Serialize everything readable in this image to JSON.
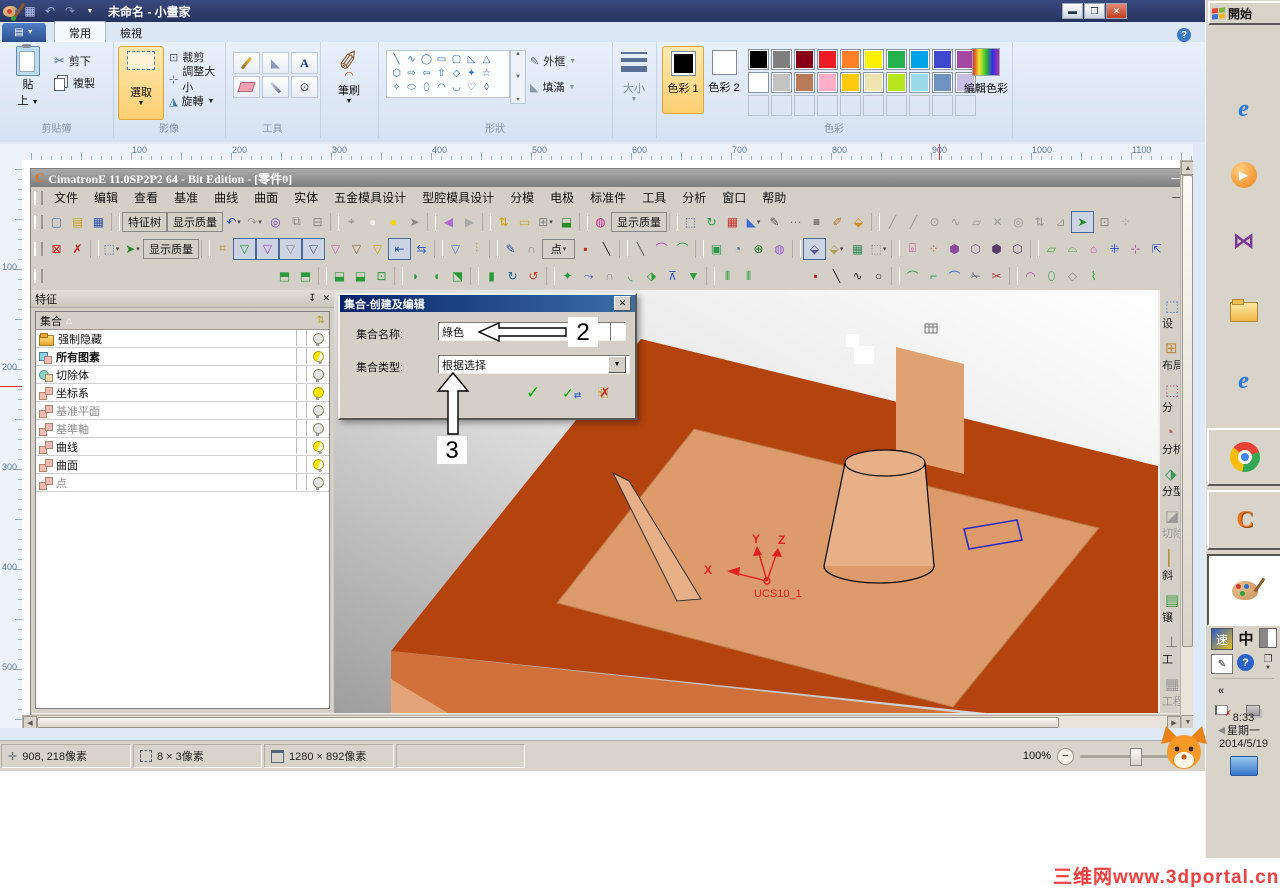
{
  "colors": {
    "model_top": "#b5430d",
    "model_front": "#d0703a",
    "model_pocket": "#dd9b6b",
    "model_boss": "#e0a173",
    "model_cyl": "#e7b086",
    "model_bevel": "#e2a478",
    "ucs": "#e02020",
    "selection_blue": "#2a2ac8"
  },
  "paint": {
    "window_title": "未命名 - 小畫家",
    "tabs": [
      {
        "label": "常用",
        "active": true
      },
      {
        "label": "檢視",
        "active": false
      }
    ],
    "help_icon": "?",
    "clipboard": {
      "group": "剪貼簿",
      "paste1": "貼",
      "paste2": "上",
      "cut": "剪下",
      "copy": "複製"
    },
    "image": {
      "group": "影像",
      "select": "選取",
      "crop": "裁剪",
      "resize": "調整大小",
      "rotate": "旋轉"
    },
    "tools_group": "工具",
    "brush_label": "筆刷",
    "shapes": {
      "group": "形狀",
      "outline": "外框",
      "fill": "填滿",
      "rows": [
        [
          "╲",
          "∿",
          "◯",
          "▭",
          "▢",
          "◺",
          "△"
        ],
        [
          "⬡",
          "⇨",
          "⇦",
          "⇧",
          "◇",
          "✦",
          "☆"
        ],
        [
          "✧",
          "⬭",
          "⬯",
          "◠",
          "◡",
          "♡",
          "◊"
        ]
      ]
    },
    "size_label": "大小",
    "colors_group": {
      "group": "色彩",
      "c1_label": "色彩 1",
      "c2_label": "色彩 2",
      "edit_label": "編輯色彩",
      "color1": "#000000",
      "color2": "#ffffff",
      "row1": [
        "#000000",
        "#7f7f7f",
        "#880015",
        "#ed1c24",
        "#ff7f27",
        "#fff200",
        "#22b14c",
        "#00a2e8",
        "#3f48cc",
        "#a349a4"
      ],
      "row2": [
        "#ffffff",
        "#c3c3c3",
        "#b97a57",
        "#ffaec9",
        "#ffc90e",
        "#efe4b0",
        "#b5e61d",
        "#99d9ea",
        "#7092be",
        "#c8bfe7"
      ]
    },
    "ruler_h": [
      100,
      200,
      300,
      400,
      500,
      600,
      700,
      800,
      900,
      1000,
      1100
    ],
    "ruler_v": [
      100,
      200,
      300,
      400,
      500
    ],
    "status": {
      "pos": "908, 218像素",
      "sel": "8 × 3像素",
      "size": "1280 × 892像素",
      "zoom": "100%"
    }
  },
  "cimatron": {
    "title": "CimatronE 11.0SP2P2 64 - Bit Edition - [零件0]",
    "menus": [
      "文件",
      "编辑",
      "查看",
      "基准",
      "曲线",
      "曲面",
      "实体",
      "五金模具设计",
      "型腔模具设计",
      "分模",
      "电极",
      "标准件",
      "工具",
      "分析",
      "窗口",
      "帮助"
    ],
    "toolbar1": [
      {
        "n": "new-file",
        "g": "▢",
        "c": "#4a6fae"
      },
      {
        "n": "open-file",
        "g": "▤",
        "c": "#c8a020"
      },
      {
        "n": "save-file",
        "g": "▦",
        "c": "#3355aa"
      },
      {
        "sep": 1
      },
      {
        "n": "feature-tree-button",
        "t": "特征树",
        "box": 1
      },
      {
        "n": "display-quality-button",
        "t": "显示质量"
      },
      {
        "n": "undo",
        "g": "↶",
        "c": "#2244cc",
        "dd": 1
      },
      {
        "n": "redo",
        "g": "↷",
        "c": "#9a9a9a",
        "dd": 1
      },
      {
        "n": "glasses",
        "g": "◎",
        "c": "#7a3cc8"
      },
      {
        "n": "copy-reference",
        "g": "⧉",
        "c": "#888"
      },
      {
        "n": "delete-reference",
        "g": "⊟",
        "c": "#888"
      },
      {
        "sep": 1
      },
      {
        "n": "bulb-pick",
        "g": "⌖",
        "c": "#888"
      },
      {
        "n": "bulb-white",
        "g": "●",
        "c": "#eee"
      },
      {
        "n": "bulb-yellow",
        "g": "●",
        "c": "#ffd700"
      },
      {
        "n": "bulb-cursor",
        "g": "➤",
        "c": "#888"
      },
      {
        "sep": 1
      },
      {
        "n": "back-arrow",
        "g": "◀",
        "c": "#b06ad0"
      },
      {
        "n": "forward-arrow",
        "g": "▶",
        "c": "#aaa"
      },
      {
        "sep": 1
      },
      {
        "n": "swap-entities",
        "g": "⇅",
        "c": "#d0a000"
      },
      {
        "n": "measure-ruler",
        "g": "▭",
        "c": "#caa520"
      },
      {
        "n": "grid-toggle",
        "g": "⊞",
        "c": "#888",
        "dd": 1
      },
      {
        "n": "add-stock",
        "g": "⬓",
        "c": "#2a8a2a"
      },
      {
        "sep": 1
      },
      {
        "n": "render-globe",
        "g": "◍",
        "c": "#cc2a8a"
      },
      {
        "n": "display-quality-button-2",
        "t": "显示质量"
      },
      {
        "sep": 1
      },
      {
        "n": "select-box",
        "g": "⬚",
        "c": "#4466aa"
      },
      {
        "n": "rotate-entity",
        "g": "↻",
        "c": "#2a9a4a"
      },
      {
        "n": "color-table",
        "g": "▦",
        "c": "#cc3333"
      },
      {
        "n": "fill-color",
        "g": "◣",
        "c": "#3a6ad0",
        "dd": 1
      },
      {
        "n": "pen-style",
        "g": "✎",
        "c": "#555"
      },
      {
        "n": "line-style",
        "g": "⋯",
        "c": "#777"
      },
      {
        "n": "line-width",
        "g": "≡",
        "c": "#222"
      },
      {
        "n": "brush-render",
        "g": "✐",
        "c": "#b07030"
      },
      {
        "n": "cube-gold",
        "g": "⬙",
        "c": "#d09020"
      },
      {
        "sep": 1
      },
      {
        "n": "sketch-line",
        "g": "╱",
        "c": "#999"
      },
      {
        "n": "sketch-line2",
        "g": "╱",
        "c": "#999"
      },
      {
        "n": "axis-circle",
        "g": "⊙",
        "c": "#999"
      },
      {
        "n": "curve-tool",
        "g": "∿",
        "c": "#999"
      },
      {
        "n": "plane-tool",
        "g": "▱",
        "c": "#999"
      },
      {
        "n": "delete-tool",
        "g": "✕",
        "c": "#999"
      },
      {
        "n": "hide-tool",
        "g": "◎",
        "c": "#999"
      },
      {
        "n": "flip-tool",
        "g": "⇅",
        "c": "#999"
      },
      {
        "n": "angle-tool",
        "g": "⊿",
        "c": "#999"
      },
      {
        "n": "pick-green",
        "g": "➤",
        "c": "#2a8a2a",
        "box": 1
      },
      {
        "n": "pick-box",
        "g": "⊡",
        "c": "#888"
      },
      {
        "n": "xyz-points",
        "g": "⁘",
        "c": "#999"
      }
    ],
    "toolbar2": [
      {
        "n": "selection-red-box",
        "g": "⊠",
        "c": "#cc2222"
      },
      {
        "n": "cursor-x",
        "g": "✗",
        "c": "#cc2222"
      },
      {
        "sep": 1
      },
      {
        "n": "marquee-cursor",
        "g": "⬚",
        "c": "#4466aa",
        "dd": 1
      },
      {
        "n": "pick-arrow",
        "g": "➤",
        "c": "#2a8a2a",
        "dd": 1
      },
      {
        "n": "display-quality-button-3",
        "t": "显示质量"
      },
      {
        "sep": 1
      },
      {
        "n": "filter-settings",
        "g": "⌗",
        "c": "#cc8a2a"
      },
      {
        "n": "filter-solid",
        "g": "▽",
        "c": "#2a9a2a",
        "box": 1
      },
      {
        "n": "filter-curve",
        "g": "▽",
        "c": "#b040c0",
        "box": 1
      },
      {
        "n": "filter-edge",
        "g": "▽",
        "c": "#888",
        "box": 1
      },
      {
        "n": "filter-point",
        "g": "▽",
        "c": "#556688",
        "box": 1
      },
      {
        "n": "filter-pink",
        "g": "▽",
        "c": "#d060c0"
      },
      {
        "n": "filter-drill",
        "g": "▽",
        "c": "#8a6a3a"
      },
      {
        "n": "filter-gold",
        "g": "▽",
        "c": "#d0a020"
      },
      {
        "n": "filter-dim",
        "g": "⇤",
        "c": "#3355aa",
        "box": 1
      },
      {
        "n": "filter-list",
        "g": "⇆",
        "c": "#3366cc"
      },
      {
        "sep": 1
      },
      {
        "n": "pick-filter",
        "g": "▽",
        "c": "#5577cc"
      },
      {
        "n": "rain-filter",
        "g": "⫶",
        "c": "#cc9a20"
      },
      {
        "sep": 1
      },
      {
        "n": "sketcher",
        "g": "✎",
        "c": "#3355aa"
      },
      {
        "n": "spline",
        "g": "∩",
        "c": "#888"
      },
      {
        "n": "point-button",
        "t": "点",
        "dd": 1
      },
      {
        "n": "point-red",
        "g": "▪",
        "c": "#cc2222"
      },
      {
        "n": "line-black",
        "g": "╲",
        "c": "#222"
      },
      {
        "sep": 1
      },
      {
        "n": "line-gray",
        "g": "╲",
        "c": "#555"
      },
      {
        "n": "arc-magenta",
        "g": "⌒",
        "c": "#c040c0"
      },
      {
        "n": "arc-green",
        "g": "⌒",
        "c": "#2a9a4a"
      },
      {
        "sep": 1
      },
      {
        "n": "render-box",
        "g": "▣",
        "c": "#2a9a4a"
      },
      {
        "n": "zoom-view",
        "g": "◔",
        "c": "#3a6a9a"
      },
      {
        "n": "zoom-plus",
        "g": "⊕",
        "c": "#2a7a2a"
      },
      {
        "n": "orbit-view",
        "g": "◍",
        "c": "#9a5ad0"
      },
      {
        "sep": 1
      },
      {
        "n": "shaded-cube",
        "g": "⬙",
        "c": "#5a5a9a",
        "box": 1
      },
      {
        "n": "wire-cube",
        "g": "⬙",
        "c": "#b0a060",
        "dd": 1
      },
      {
        "n": "section-cube",
        "g": "▦",
        "c": "#3a8a5a"
      },
      {
        "n": "cube-dropdown",
        "g": "⬚",
        "c": "#888",
        "dd": 1
      },
      {
        "sep": 1
      },
      {
        "n": "mirror-pink",
        "g": "⌻",
        "c": "#d040a0"
      },
      {
        "n": "multi-color",
        "g": "⁘",
        "c": "#cc6622"
      },
      {
        "n": "cube-purple-1",
        "g": "⬢",
        "c": "#8a4a9a"
      },
      {
        "n": "cube-purple-2",
        "g": "⬡",
        "c": "#8a4a9a"
      },
      {
        "n": "cube-dark-1",
        "g": "⬢",
        "c": "#5a3a6a"
      },
      {
        "n": "cube-dark-2",
        "g": "⬡",
        "c": "#5a3a6a"
      },
      {
        "sep": 1
      },
      {
        "n": "plane-green",
        "g": "▱",
        "c": "#4aaa3a"
      },
      {
        "n": "surface-fold",
        "g": "⌓",
        "c": "#4aaa3a"
      },
      {
        "n": "surface-pink",
        "g": "⌂",
        "c": "#d050b0"
      },
      {
        "n": "ucs-blue",
        "g": "⁜",
        "c": "#3355cc"
      },
      {
        "n": "ucs-pink",
        "g": "⊹",
        "c": "#c050b0"
      },
      {
        "n": "ucs-move",
        "g": "⇱",
        "c": "#3355cc"
      }
    ],
    "toolbar3": [
      {
        "gap": 228
      },
      {
        "n": "solid-new-1",
        "g": "⬒",
        "c": "#2a9a3a"
      },
      {
        "n": "solid-new-2",
        "g": "⬒",
        "c": "#2a9a3a"
      },
      {
        "sep": 1
      },
      {
        "n": "solid-copy-1",
        "g": "⬓",
        "c": "#2a9a3a"
      },
      {
        "n": "solid-copy-2",
        "g": "⬓",
        "c": "#2a9a3a"
      },
      {
        "n": "solid-box",
        "g": "⊡",
        "c": "#2a9a3a"
      },
      {
        "sep": 1
      },
      {
        "n": "solid-round-1",
        "g": "◗",
        "c": "#2a9a3a"
      },
      {
        "n": "solid-round-2",
        "g": "◖",
        "c": "#2a9a3a"
      },
      {
        "n": "solid-extrude",
        "g": "⬔",
        "c": "#2a9a3a"
      },
      {
        "sep": 1
      },
      {
        "n": "solid-rib",
        "g": "▮",
        "c": "#2a9a3a"
      },
      {
        "n": "solid-revolve",
        "g": "↻",
        "c": "#2a6a9a"
      },
      {
        "n": "solid-remove",
        "g": "↺",
        "c": "#cc3a2a"
      },
      {
        "sep": 1
      },
      {
        "n": "surf-star-1",
        "g": "✦",
        "c": "#2a9a3a"
      },
      {
        "n": "surf-sweep",
        "g": "⤳",
        "c": "#3355cc"
      },
      {
        "n": "surf-arc",
        "g": "∩",
        "c": "#888"
      },
      {
        "n": "surf-corner",
        "g": "◟",
        "c": "#2a9a3a"
      },
      {
        "n": "surf-drive",
        "g": "⬗",
        "c": "#2a9a3a"
      },
      {
        "n": "surf-mid",
        "g": "⊼",
        "c": "#3355cc"
      },
      {
        "n": "surf-down",
        "g": "▼",
        "c": "#2a9a3a"
      },
      {
        "sep": 1
      },
      {
        "n": "surf-pair-1",
        "g": "⫴",
        "c": "#2a9a3a"
      },
      {
        "n": "surf-pair-2",
        "g": "⫴",
        "c": "#2a9a3a"
      },
      {
        "gap": 46
      },
      {
        "n": "pt-red",
        "g": "▪",
        "c": "#cc2222"
      },
      {
        "n": "line-tool",
        "g": "╲",
        "c": "#222"
      },
      {
        "n": "curve-tool",
        "g": "∿",
        "c": "#222"
      },
      {
        "n": "circle-tool",
        "g": "○",
        "c": "#222"
      },
      {
        "sep": 1
      },
      {
        "n": "fillet-1",
        "g": "⌒",
        "c": "#2a9a3a"
      },
      {
        "n": "chamfer",
        "g": "⌐",
        "c": "#2a9a3a"
      },
      {
        "n": "fillet-2",
        "g": "⌒",
        "c": "#3a6ad0"
      },
      {
        "n": "trim-1",
        "g": "✁",
        "c": "#556688"
      },
      {
        "n": "trim-2",
        "g": "✂",
        "c": "#c03a3a"
      },
      {
        "sep": 1
      },
      {
        "n": "surface-pink-2",
        "g": "◠",
        "c": "#c040c0"
      },
      {
        "n": "surface-cyl",
        "g": "⬯",
        "c": "#2a9a3a"
      },
      {
        "n": "surface-gray",
        "g": "◇",
        "c": "#888"
      },
      {
        "n": "surface-waves",
        "g": "⌇",
        "c": "#2a9a3a"
      }
    ],
    "feature_panel": {
      "title": "特征",
      "header": "集合",
      "header_sort": "△",
      "rows": [
        {
          "label": "强制隐藏",
          "icon": "folder",
          "bulb": "gray"
        },
        {
          "label": "所有图素",
          "icon": "elements",
          "bulb": "half",
          "bold": true
        },
        {
          "label": "切除体",
          "icon": "cut",
          "bulb": "gray"
        },
        {
          "label": "坐标系",
          "icon": "set",
          "bulb": "yellow"
        },
        {
          "label": "基准平面",
          "icon": "set",
          "bulb": "gray",
          "gray": true
        },
        {
          "label": "基準軸",
          "icon": "set",
          "bulb": "gray",
          "gray": true
        },
        {
          "label": "曲线",
          "icon": "set",
          "bulb": "half"
        },
        {
          "label": "曲面",
          "icon": "set",
          "bulb": "half"
        },
        {
          "label": "点",
          "icon": "set",
          "bulb": "gray",
          "gray": true
        }
      ]
    },
    "dialog": {
      "title": "集合-创建及编辑",
      "name_label": "集合名称:",
      "name_value": "綠色",
      "type_label": "集合类型:",
      "type_value": "根据选择",
      "annotation2": "2",
      "annotation3": "3"
    },
    "viewport": {
      "axis_x": "X",
      "axis_y": "Y",
      "axis_z": "Z",
      "ucs_label": "UCS10_1"
    },
    "right_toolbar": [
      {
        "label": "设",
        "g": "⬚",
        "c": "#4a7ac0"
      },
      {
        "label": "布局",
        "g": "⊞",
        "c": "#c08a3a"
      },
      {
        "label": "分",
        "g": "⬚",
        "c": "#c04a9a"
      },
      {
        "label": "分析",
        "g": "◔",
        "c": "#c05a5a"
      },
      {
        "label": "分型",
        "g": "⬗",
        "c": "#3a9a5a"
      },
      {
        "label": "切除",
        "g": "◪",
        "c": "#999",
        "gray": true
      },
      {
        "label": "斜",
        "g": "⎮",
        "c": "#b8862a"
      },
      {
        "label": "镶",
        "g": "▤",
        "c": "#3a9a3a"
      },
      {
        "label": "工",
        "g": "⊥",
        "c": "#777"
      },
      {
        "label": "工程",
        "g": "▦",
        "c": "#999",
        "gray": true
      }
    ]
  },
  "taskbar": {
    "start_label": "開始",
    "ime_a": "速",
    "ime_b": "中",
    "chevron": "«",
    "clock": {
      "time": "8:33",
      "weekday": "星期一",
      "date": "2014/5/19"
    }
  },
  "watermark": "三维网www.3dportal.cn"
}
